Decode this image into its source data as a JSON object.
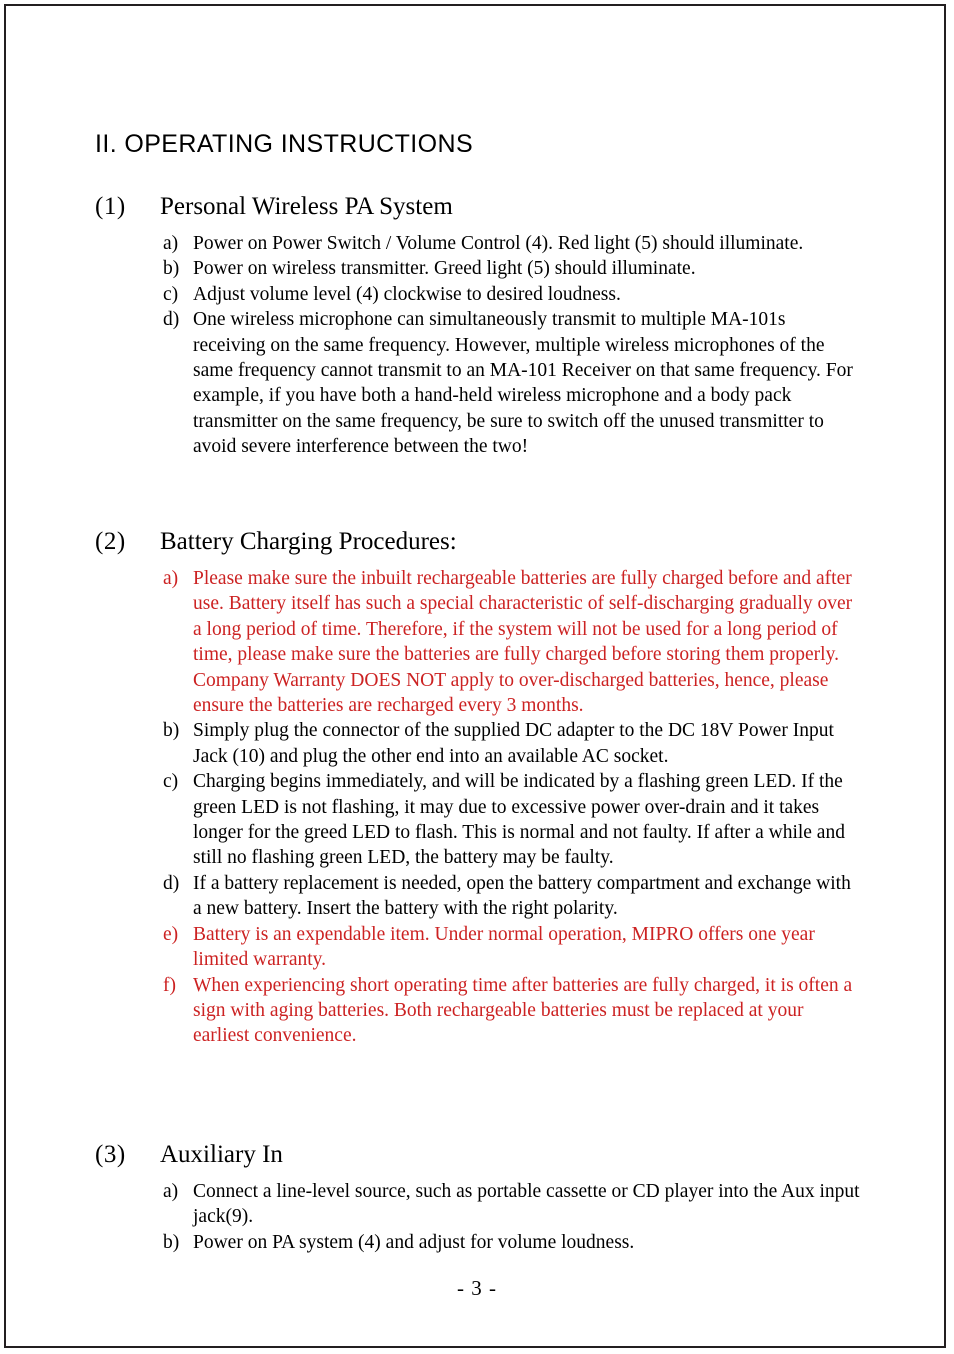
{
  "document": {
    "chapter_title": "II. OPERATING INSTRUCTIONS",
    "page_number": "- 3 -",
    "text_color": "#000000",
    "highlight_color": "#cc2222"
  },
  "sections": [
    {
      "number": "(1)",
      "title": "Personal Wireless PA System",
      "items": [
        {
          "marker": "a)",
          "text": "Power on Power Switch / Volume Control (4).  Red light (5) should illuminate.",
          "color": "black"
        },
        {
          "marker": "b)",
          "text": "Power on wireless transmitter. Greed light (5) should illuminate.",
          "color": "black"
        },
        {
          "marker": "c)",
          "text": "Adjust volume level (4) clockwise to desired loudness.",
          "color": "black"
        },
        {
          "marker": "d)",
          "text": "One wireless microphone can simultaneously transmit to multiple MA-101s receiving on the same frequency.   However, multiple wireless microphones of the same frequency cannot transmit to an MA-101 Receiver on that same frequency.  For example, if you have both a hand-held wireless microphone and a body pack transmitter on the same frequency, be sure to switch off the unused transmitter to avoid severe interference between the two!",
          "color": "black"
        }
      ]
    },
    {
      "number": "(2)",
      "title": "Battery Charging Procedures:",
      "items": [
        {
          "marker": "a)",
          "text": "Please make sure the inbuilt rechargeable batteries are fully charged before and after use.  Battery itself has such a special characteristic of self-discharging gradually over a long period of time.  Therefore, if the system will not be used for a long period of time, please make sure the batteries are fully charged before storing them properly.  Company Warranty DOES NOT apply to over-discharged batteries, hence, please ensure the batteries are recharged every 3 months.",
          "color": "red"
        },
        {
          "marker": "b)",
          "text": "Simply plug the connector of the supplied DC adapter to the DC 18V Power Input Jack (10) and plug the other end into an available AC socket.",
          "color": "black"
        },
        {
          "marker": "c)",
          "text": "Charging begins immediately, and will be indicated by a flashing green LED.  If the green LED is not flashing, it may due to excessive power over-drain and it takes longer for the greed LED to flash.  This is normal and not faulty.  If after a while and still no flashing green LED, the battery may be faulty.",
          "color": "black"
        },
        {
          "marker": "d)",
          "text": "If a battery replacement is needed, open the battery compartment and exchange with a new battery.  Insert the battery with the right polarity.",
          "color": "black"
        },
        {
          "marker": "e)",
          "text": "Battery is an expendable item.  Under normal operation, MIPRO offers one year limited warranty.",
          "color": "red"
        },
        {
          "marker": "f)",
          "text": "When experiencing short operating time after batteries are fully charged, it is often a sign with aging batteries.  Both rechargeable batteries must be replaced at your earliest convenience.",
          "color": "red"
        }
      ]
    },
    {
      "number": "(3)",
      "title": "Auxiliary In",
      "items": [
        {
          "marker": "a)",
          "text": "Connect a line-level source, such as portable cassette or CD player into the Aux input jack(9).",
          "color": "black"
        },
        {
          "marker": "b)",
          "text": "Power on PA system (4) and adjust for volume loudness.",
          "color": "black"
        }
      ]
    }
  ]
}
